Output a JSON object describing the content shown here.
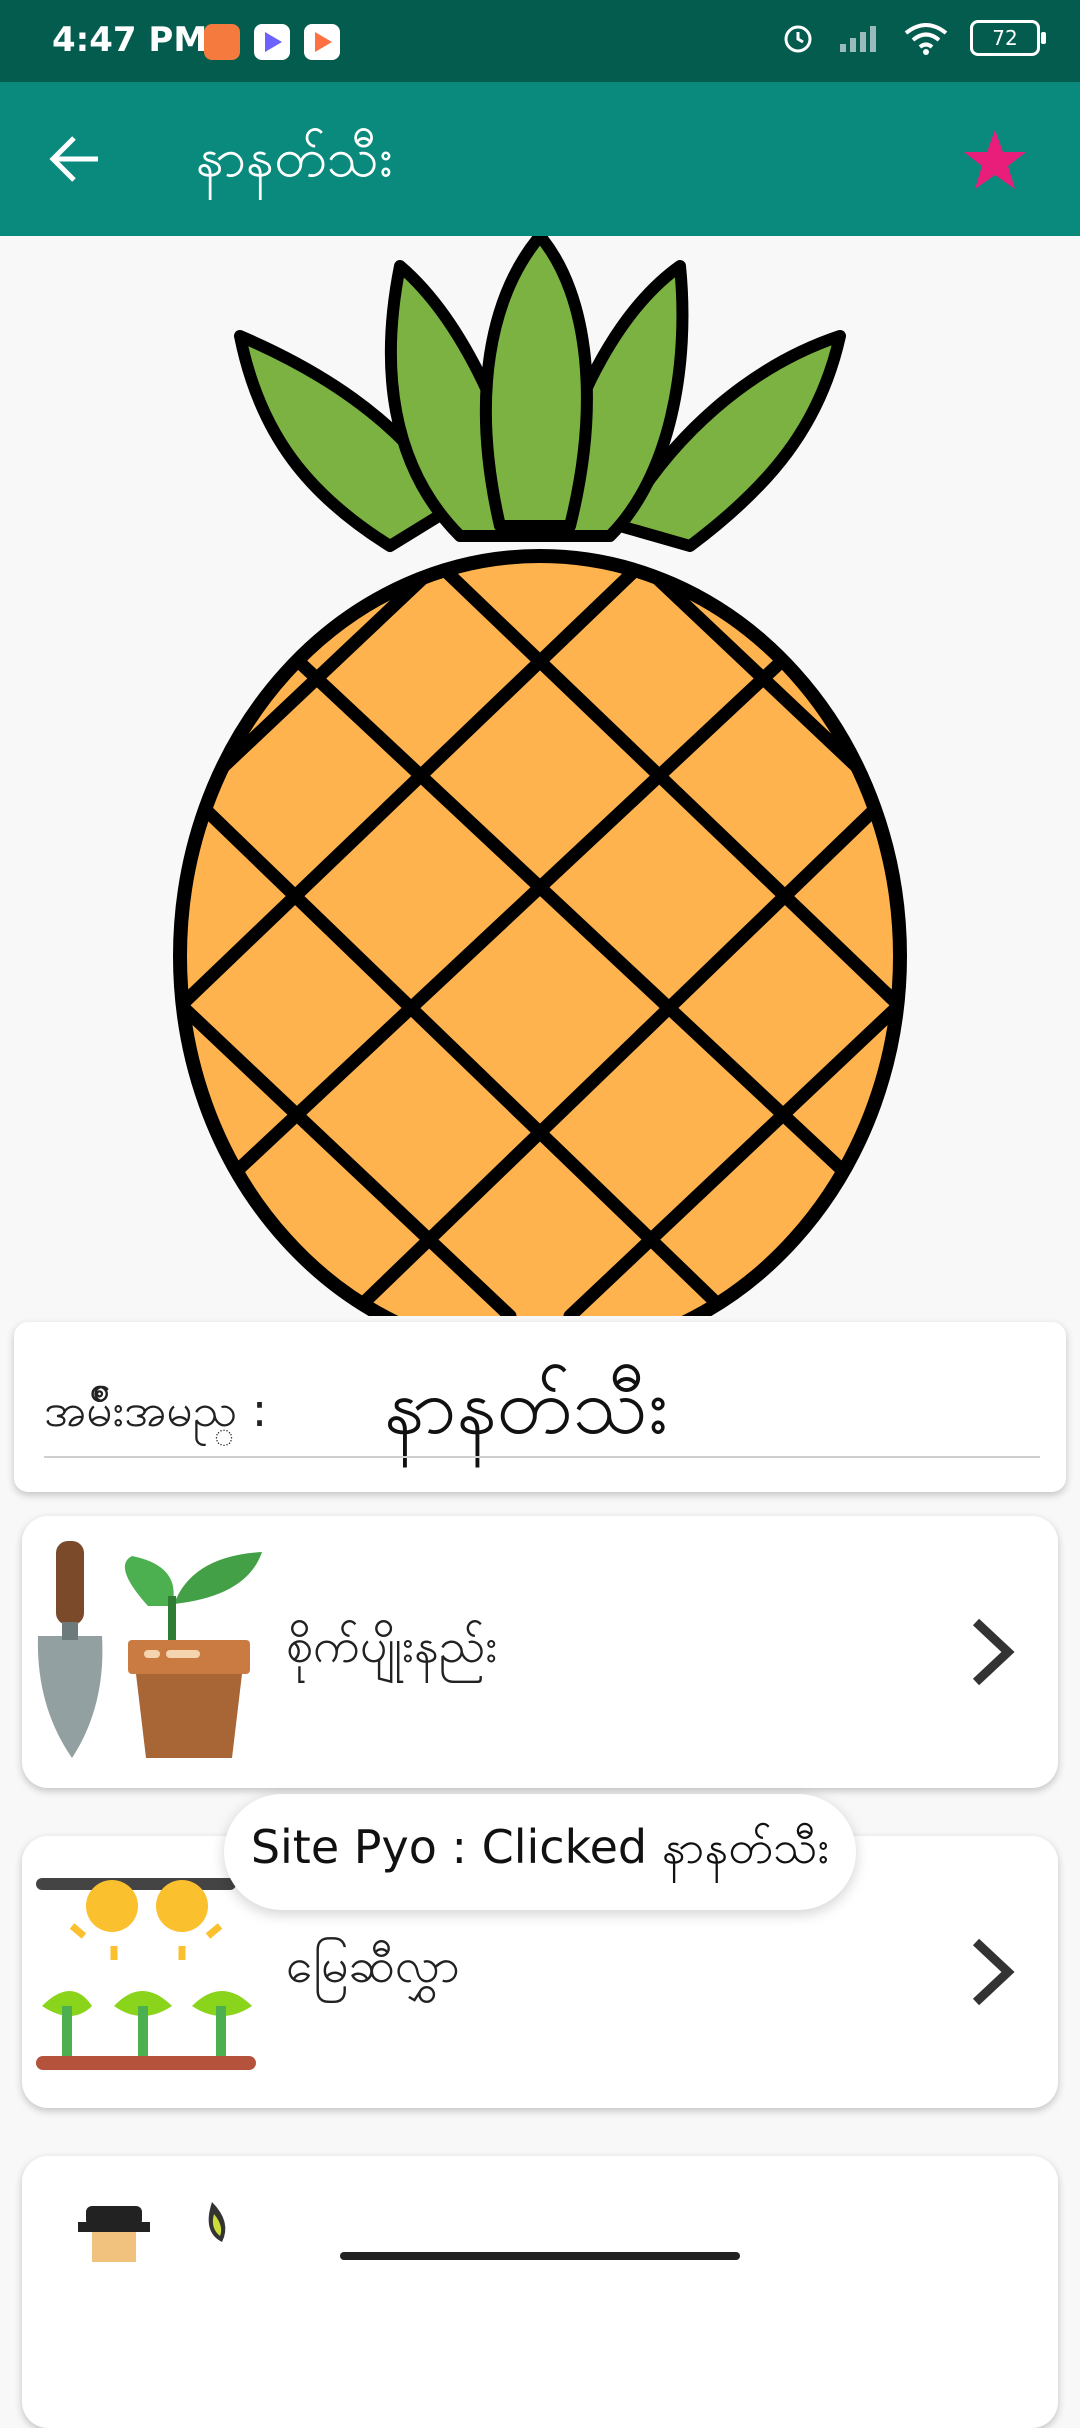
{
  "status_bar": {
    "time": "4:47 PM",
    "battery": "72",
    "icons": [
      "shopping-bag-icon",
      "play-store-icon",
      "play-store-icon",
      "alarm-icon",
      "signal-icon",
      "wifi-icon",
      "battery-icon"
    ]
  },
  "app_bar": {
    "title": "နာနတ်သီး",
    "back_icon": "arrow-back-icon",
    "favorite_icon": "star-icon",
    "colors": {
      "status_bar": "#045c4f",
      "app_bar": "#0a8a7c",
      "star": "#e91e7a"
    }
  },
  "hero": {
    "image": "pineapple-illustration"
  },
  "name_card": {
    "label": "အမ်ိဳးအမည္ :",
    "value": "နာနတ်သီး"
  },
  "menu": [
    {
      "label": "စိုက်ပျိုးနည်း",
      "icon": "trowel-plant-pot-icon"
    },
    {
      "label": "မြေဆီလွှာ",
      "icon": "sun-seedlings-icon"
    },
    {
      "label": "",
      "icon": "farmer-icon"
    }
  ],
  "toast": {
    "text": "Site Pyo : Clicked နာနတ်သီး"
  }
}
